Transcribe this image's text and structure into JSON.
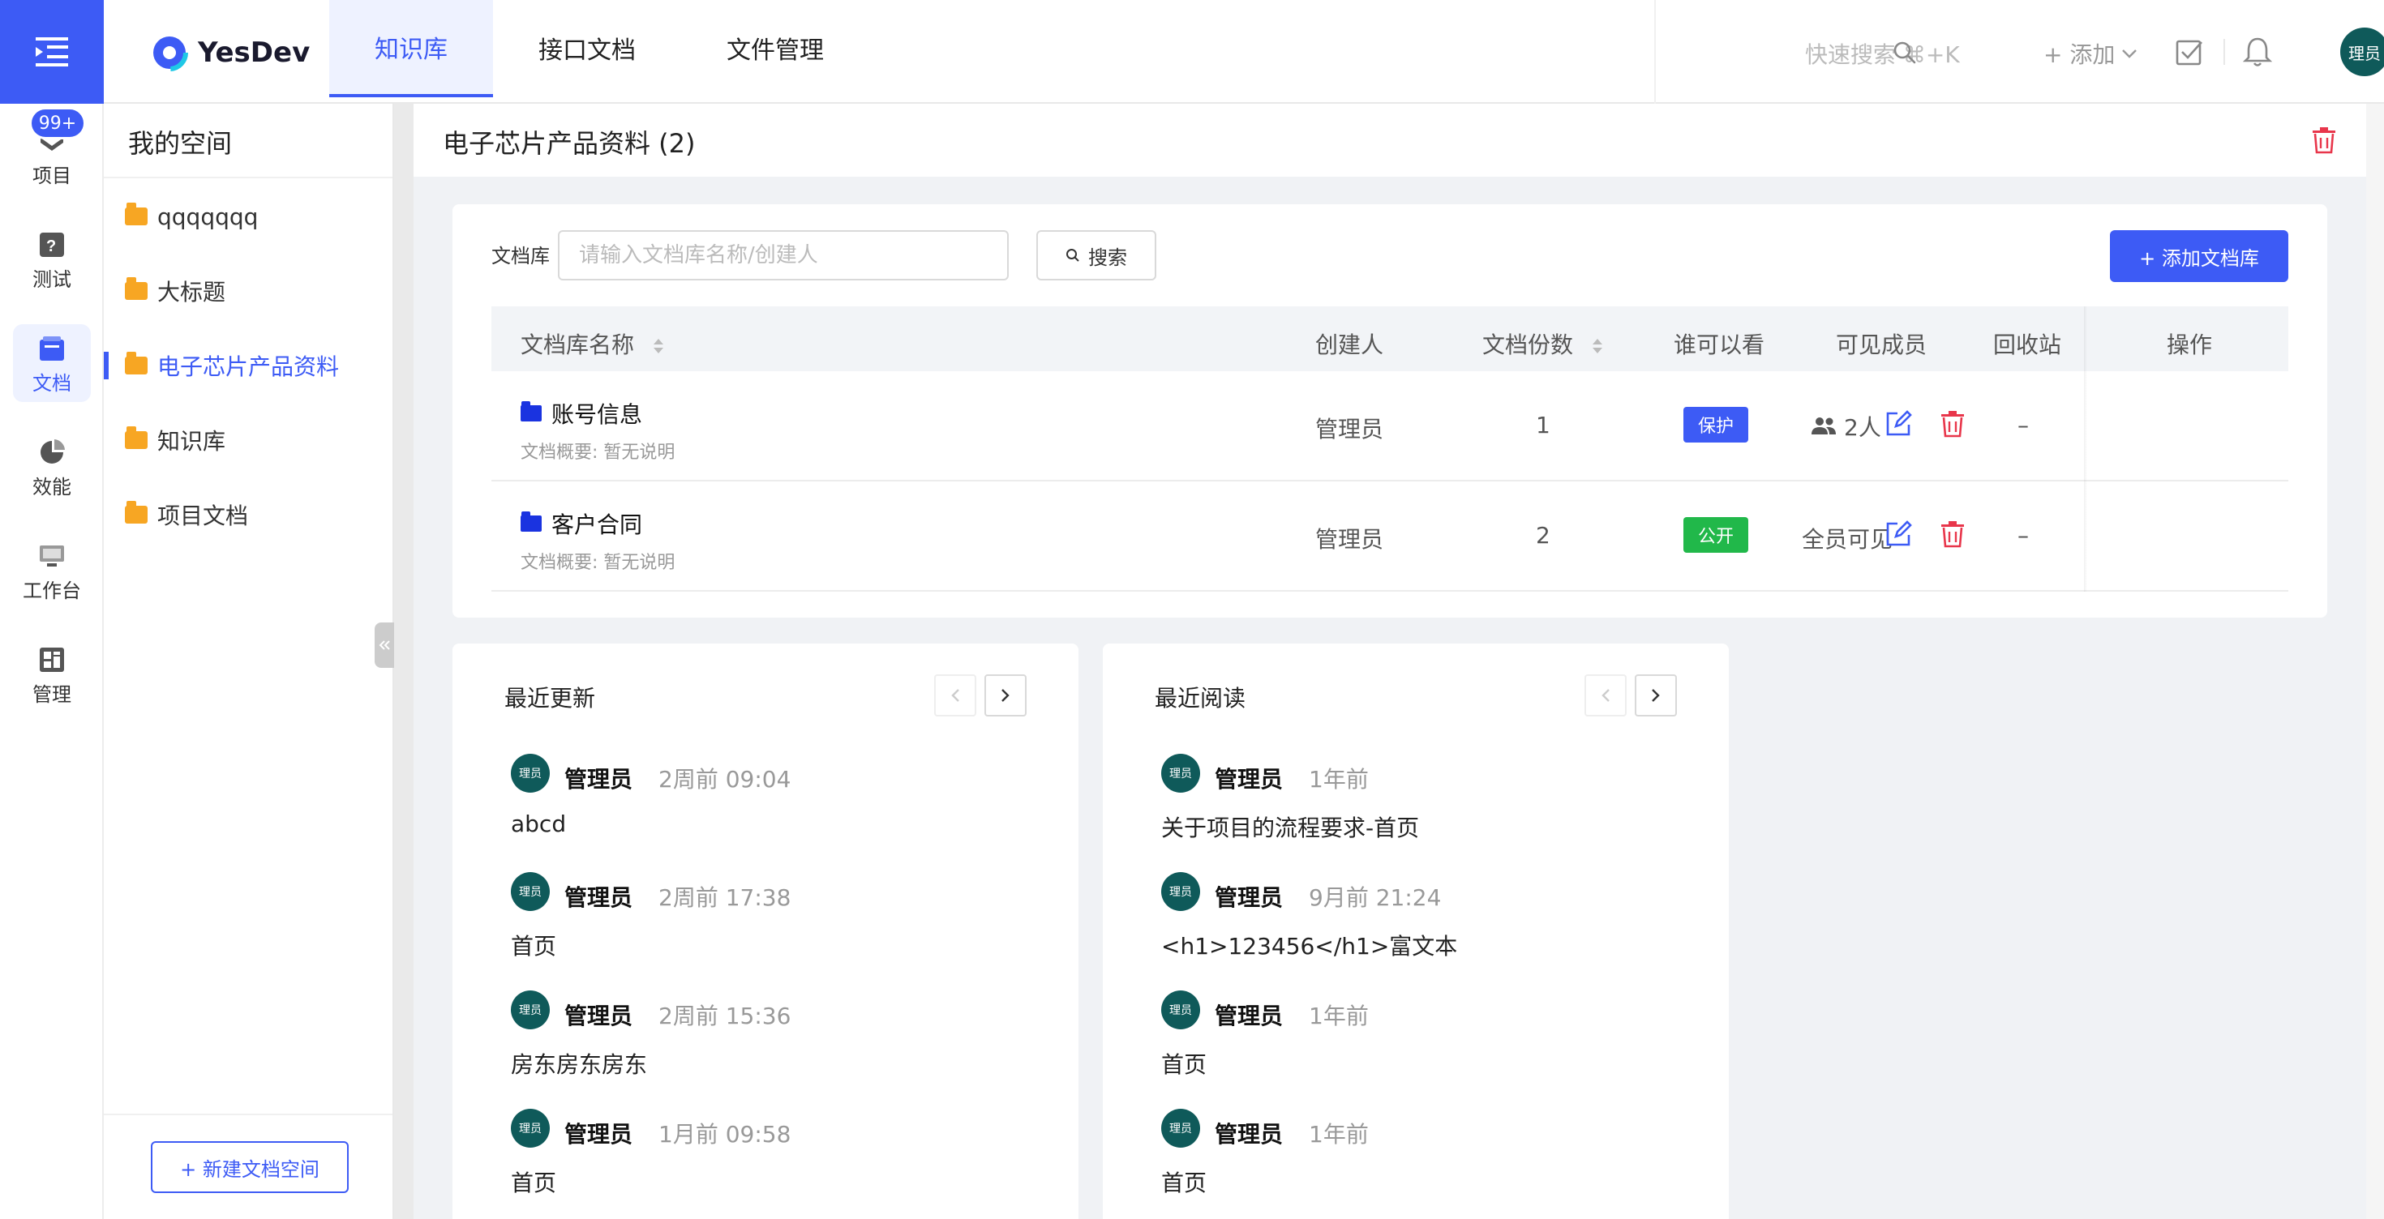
{
  "app": {
    "logo_text": "YesDev"
  },
  "top_nav": {
    "tabs": [
      "知识库",
      "接口文档",
      "文件管理"
    ],
    "active_tab": 0
  },
  "toolbar": {
    "quick_search": "快速搜索 ⌘+K",
    "add_label": "+ 添加",
    "user_avatar": "理员"
  },
  "rail": {
    "badge": "99+",
    "items": [
      {
        "label": "项目",
        "icon": "project-icon"
      },
      {
        "label": "测试",
        "icon": "test-icon"
      },
      {
        "label": "文档",
        "icon": "document-icon",
        "active": true
      },
      {
        "label": "效能",
        "icon": "pie-chart-icon"
      },
      {
        "label": "工作台",
        "icon": "monitor-icon"
      },
      {
        "label": "管理",
        "icon": "dashboard-icon"
      }
    ]
  },
  "space": {
    "title": "我的空间",
    "items": [
      "qqqqqqq",
      "大标题",
      "电子芯片产品资料",
      "知识库",
      "项目文档"
    ],
    "active_index": 2,
    "new_button": "+ 新建文档空间"
  },
  "content": {
    "title": "电子芯片产品资料 (2)"
  },
  "library": {
    "filter_label": "文档库",
    "search_placeholder": "请输入文档库名称/创建人",
    "search_button": "搜索",
    "add_button": "+ 添加文档库",
    "columns": [
      "文档库名称",
      "创建人",
      "文档份数",
      "谁可以看",
      "可见成员",
      "回收站",
      "操作"
    ],
    "rows": [
      {
        "name": "账号信息",
        "desc": "文档概要: 暂无说明",
        "creator": "管理员",
        "count": "1",
        "visibility": "保护",
        "visibility_type": "protect",
        "members": "2人",
        "recycle": "–"
      },
      {
        "name": "客户合同",
        "desc": "文档概要: 暂无说明",
        "creator": "管理员",
        "count": "2",
        "visibility": "公开",
        "visibility_type": "public",
        "members": "全员可见",
        "recycle": "–"
      }
    ]
  },
  "recent_updates": {
    "title": "最近更新",
    "entries": [
      {
        "avatar": "理员",
        "user": "管理员",
        "time": "2周前 09:04",
        "doc": "abcd"
      },
      {
        "avatar": "理员",
        "user": "管理员",
        "time": "2周前 17:38",
        "doc": "首页"
      },
      {
        "avatar": "理员",
        "user": "管理员",
        "time": "2周前 15:36",
        "doc": "房东房东房东"
      },
      {
        "avatar": "理员",
        "user": "管理员",
        "time": "1月前 09:58",
        "doc": "首页"
      }
    ]
  },
  "recent_reads": {
    "title": "最近阅读",
    "entries": [
      {
        "avatar": "理员",
        "user": "管理员",
        "time": "1年前",
        "doc": "关于项目的流程要求-首页"
      },
      {
        "avatar": "理员",
        "user": "管理员",
        "time": "9月前 21:24",
        "doc": "<h1>123456</h1>富文本"
      },
      {
        "avatar": "理员",
        "user": "管理员",
        "time": "1年前",
        "doc": "首页"
      },
      {
        "avatar": "理员",
        "user": "管理员",
        "time": "1年前",
        "doc": "首页"
      }
    ]
  },
  "colors": {
    "primary": "#3d5bf5",
    "danger": "#e8364b",
    "success": "#21b84a",
    "avatar": "#0f5a5a"
  }
}
